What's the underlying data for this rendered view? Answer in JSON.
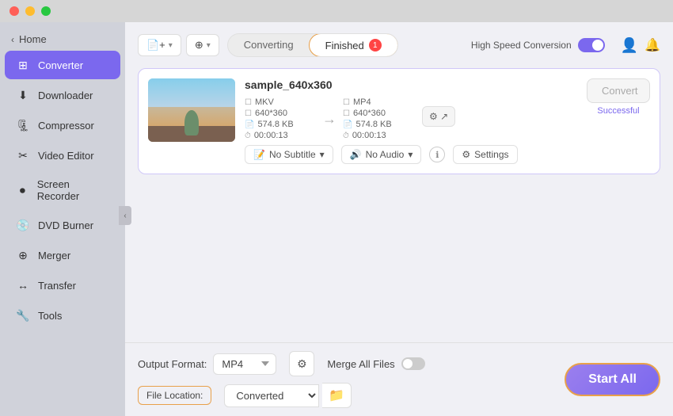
{
  "titlebar": {
    "traffic_lights": [
      "close",
      "minimize",
      "maximize"
    ]
  },
  "sidebar": {
    "home_label": "Home",
    "items": [
      {
        "id": "converter",
        "label": "Converter",
        "icon": "⊞",
        "active": true
      },
      {
        "id": "downloader",
        "label": "Downloader",
        "icon": "⬇"
      },
      {
        "id": "compressor",
        "label": "Compressor",
        "icon": "🗜"
      },
      {
        "id": "video-editor",
        "label": "Video Editor",
        "icon": "✂"
      },
      {
        "id": "screen-recorder",
        "label": "Screen Recorder",
        "icon": "⏺"
      },
      {
        "id": "dvd-burner",
        "label": "DVD Burner",
        "icon": "💿"
      },
      {
        "id": "merger",
        "label": "Merger",
        "icon": "⊕"
      },
      {
        "id": "transfer",
        "label": "Transfer",
        "icon": "↔"
      },
      {
        "id": "tools",
        "label": "Tools",
        "icon": "🔧"
      }
    ]
  },
  "toolbar": {
    "add_file_label": "Add File",
    "add_icon_label": "Add Icon"
  },
  "tabs": {
    "converting_label": "Converting",
    "finished_label": "Finished",
    "finished_badge": "1",
    "active": "finished"
  },
  "high_speed": {
    "label": "High Speed Conversion",
    "enabled": true
  },
  "file_card": {
    "filename": "sample_640x360",
    "source": {
      "format": "MKV",
      "resolution": "640*360",
      "size": "574.8 KB",
      "duration": "00:00:13"
    },
    "target": {
      "format": "MP4",
      "resolution": "640*360",
      "size": "574.8 KB",
      "duration": "00:00:13"
    },
    "subtitle": "No Subtitle",
    "audio": "No Audio",
    "convert_button": "Convert",
    "status": "Successful",
    "settings_label": "Settings"
  },
  "bottom": {
    "output_format_label": "Output Format:",
    "output_format_value": "MP4",
    "merge_label": "Merge All Files",
    "file_location_label": "File Location:",
    "file_location_value": "Converted",
    "start_all_label": "Start All",
    "folder_icon": "📁"
  },
  "user_icon": "👤",
  "notification_icon": "🔔"
}
